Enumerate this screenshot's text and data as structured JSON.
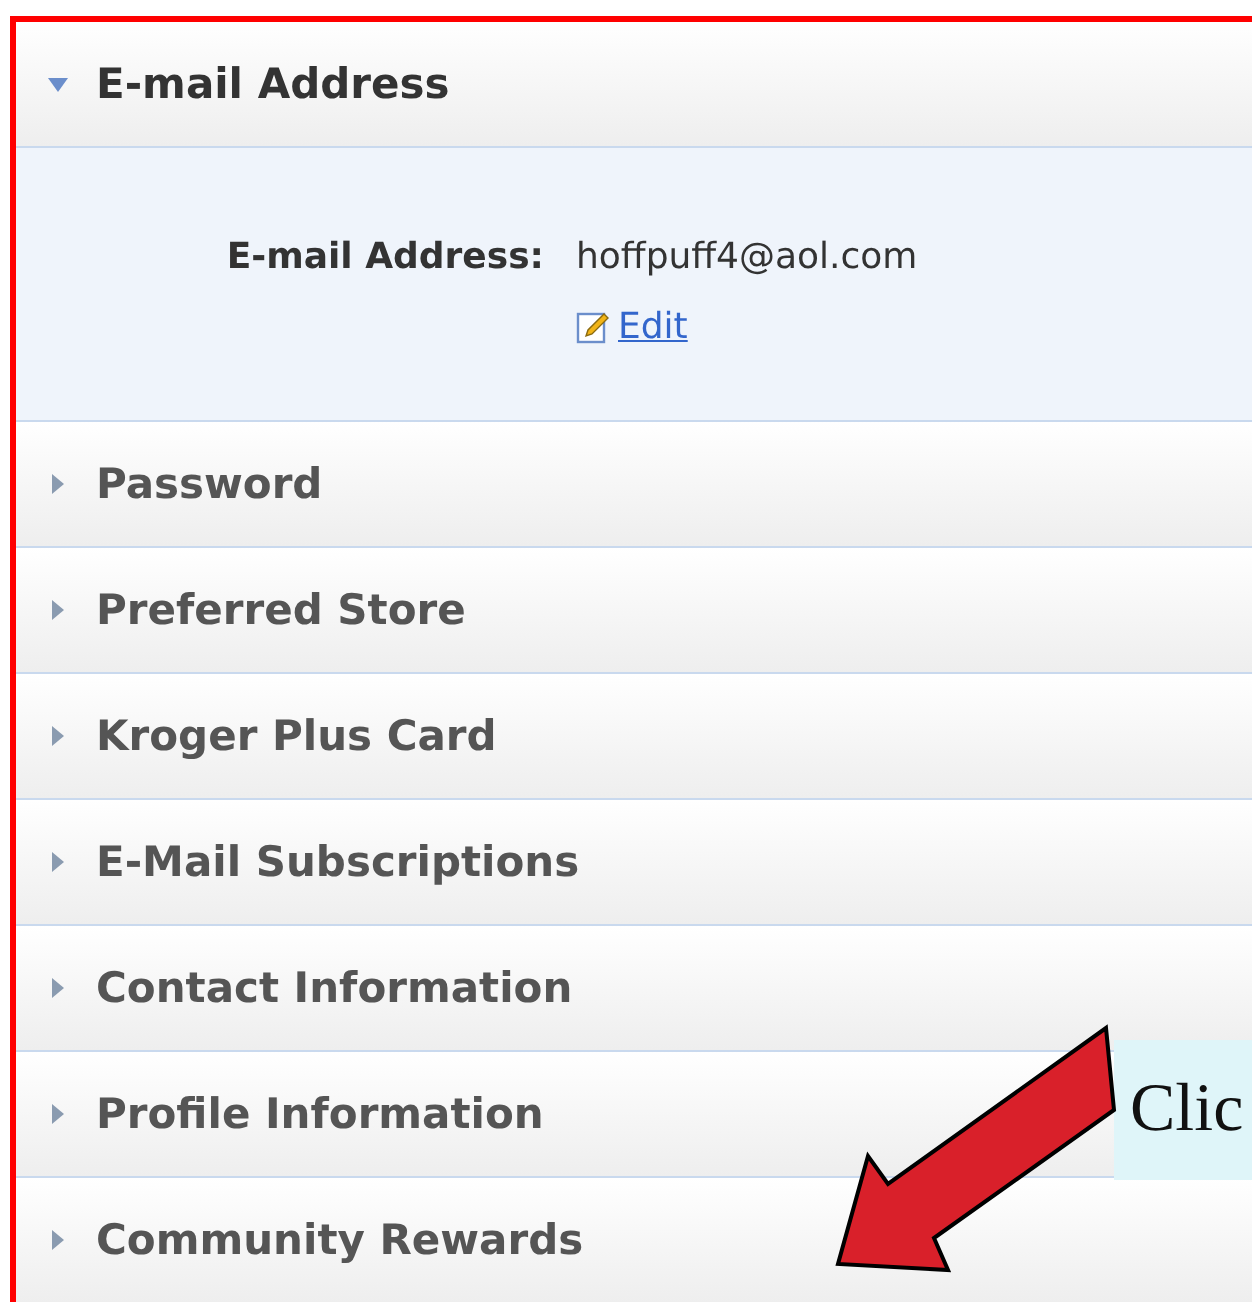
{
  "sections": [
    {
      "title": "E-mail Address",
      "expanded": true,
      "field": {
        "label": "E-mail Address:",
        "value": "hoffpuff4@aol.com",
        "action": "Edit"
      }
    },
    {
      "title": "Password",
      "expanded": false
    },
    {
      "title": "Preferred Store",
      "expanded": false
    },
    {
      "title": "Kroger Plus Card",
      "expanded": false
    },
    {
      "title": "E-Mail Subscriptions",
      "expanded": false
    },
    {
      "title": "Contact Information",
      "expanded": false
    },
    {
      "title": "Profile Information",
      "expanded": false
    },
    {
      "title": "Community Rewards",
      "expanded": false
    }
  ],
  "callout": {
    "text": "Clic"
  }
}
